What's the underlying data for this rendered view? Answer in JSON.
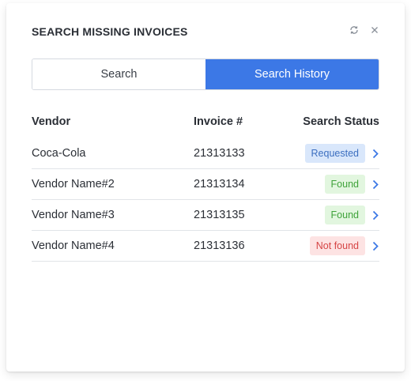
{
  "dialog": {
    "title": "SEARCH MISSING INVOICES",
    "refresh_icon": "refresh-icon",
    "close_icon": "close-icon"
  },
  "tabs": [
    {
      "label": "Search",
      "active": false
    },
    {
      "label": "Search History",
      "active": true
    }
  ],
  "table": {
    "headers": {
      "vendor": "Vendor",
      "invoice": "Invoice #",
      "status": "Search Status"
    },
    "rows": [
      {
        "vendor": "Coca-Cola",
        "invoice": "21313133",
        "status": "Requested"
      },
      {
        "vendor": "Vendor Name#2",
        "invoice": "21313134",
        "status": "Found"
      },
      {
        "vendor": "Vendor Name#3",
        "invoice": "21313135",
        "status": "Found"
      },
      {
        "vendor": "Vendor Name#4",
        "invoice": "21313136",
        "status": "Not found"
      }
    ]
  },
  "colors": {
    "accent": "#3c78e6",
    "requested_bg": "#d9e7fb",
    "requested_fg": "#3c6fc0",
    "found_bg": "#e2f6df",
    "found_fg": "#3fa33a",
    "notfound_bg": "#fde3e3",
    "notfound_fg": "#d64545"
  }
}
